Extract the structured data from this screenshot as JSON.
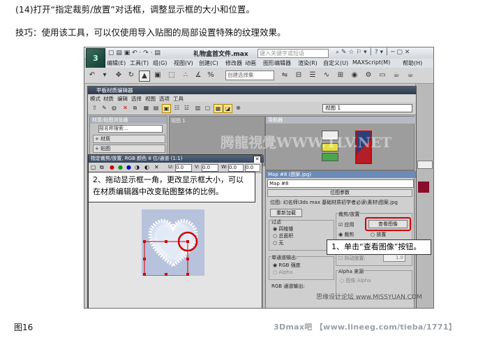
{
  "doc": {
    "line1": "(14)打开“指定裁剪/放置”对话框，调整显示框的大小和位置。",
    "line2": "技巧：使用该工具，可以仅使用导入贴图的局部设置特殊的纹理效果。",
    "figure_label": "图16",
    "footer_brand": "3Dmax吧 【www.lineeg.com/tieba/1771】"
  },
  "app": {
    "file_title": "礼物盒首文件.max",
    "search_placeholder": "键入关键字或短语",
    "logo_text": "3",
    "menu": [
      "编辑(E)",
      "工具(T)",
      "组(G)",
      "视图(V)",
      "创建(C)",
      "修改器",
      "动画",
      "图形编辑器",
      "渲染(R)",
      "自定义(U)",
      "MAXScript(M)",
      "帮助(H)"
    ],
    "selection_set": "创建选择集"
  },
  "slate": {
    "title": "平板材质编辑器",
    "menu": [
      "模式",
      "材质",
      "编辑",
      "选择",
      "视图",
      "选项",
      "工具"
    ],
    "view_select": "视图 1",
    "browser_header": "材质/贴图浏览器",
    "browser_search": "按名称搜索...",
    "rollouts": [
      "+ 材质",
      "+ 贴图"
    ],
    "view_tab": "视图 1",
    "nav_header": "导航器",
    "params_header": "Map #8 (图案.jpg)",
    "map_name": "Map #8",
    "position_rollout": "位图参数",
    "bitmap_path": "位图: 幻名师\\3ds max 基础材质初学者必读\\素材\\图案.jpg",
    "reload_label": "重新加载",
    "filter_label": "过滤",
    "filter_options": [
      "四棱锥",
      "总面积",
      "无"
    ],
    "mono_output": "单通道输出:",
    "mono_options": [
      "RGB 强度",
      "Alpha"
    ],
    "rgb_output": "RGB 通道输出:",
    "crop_group": "裁剪/放置",
    "apply_label": "应用",
    "view_image_btn": "查看图像",
    "crop_options": [
      "裁剪",
      "放置"
    ],
    "jitter_label": "抖动放置:",
    "jitter_value": "1.0",
    "alpha_source": "Alpha 来源",
    "alpha_option": "图像 Alpha"
  },
  "dialog": {
    "title": "指定裁剪/放置, RGB 颜色 8 位/通道 (1:1)",
    "field1": "0.0",
    "field2": "0.0",
    "field3": "0.0",
    "field4": "0.0"
  },
  "callouts": {
    "drag": "2、拖动显示框一角，更改显示框大小，可以在材质编辑器中改变贴图整体的比例。",
    "click": "1、单击“查看图像”按钮。"
  },
  "watermarks": {
    "tl": "腾龍視覺WWW.TLV.NET",
    "br": "思缘设计论坛 www.MISSYUAN.COM"
  },
  "colors": {
    "highlight_red": "#d40000",
    "heart_bg": "#b7c3dc"
  }
}
